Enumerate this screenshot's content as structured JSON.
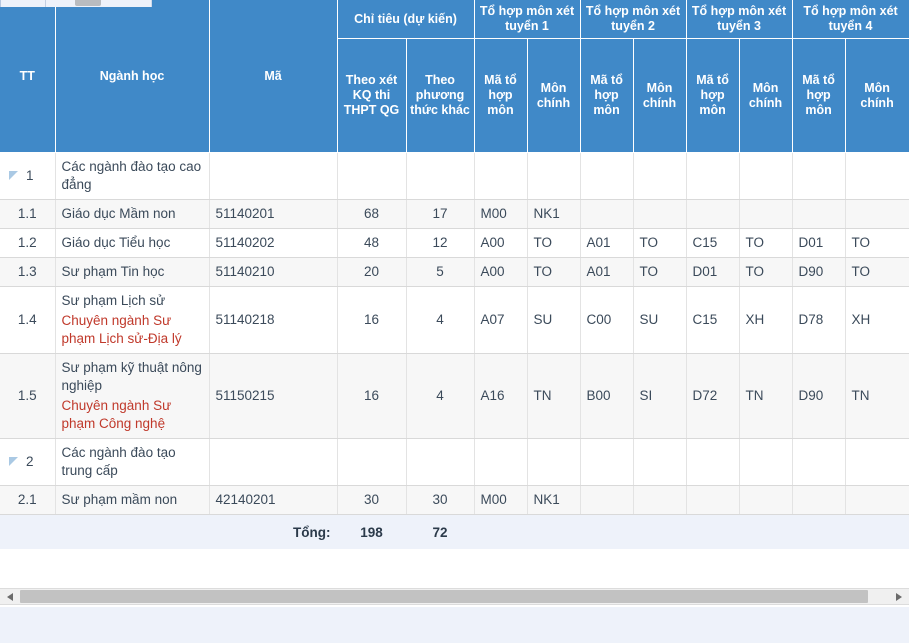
{
  "header": {
    "col_tt": "TT",
    "col_nganh": "Ngành học",
    "col_ma": "Mã",
    "group_chitieu": "Chỉ tiêu (dự kiến)",
    "sub_thpt": "Theo xét KQ thi THPT QG",
    "sub_khac": "Theo phương thức khác",
    "group_th1": "Tổ hợp môn xét tuyển 1",
    "group_th2": "Tổ hợp môn xét tuyển 2",
    "group_th3": "Tổ hợp môn xét tuyển 3",
    "group_th4": "Tổ hợp môn xét tuyển 4",
    "sub_ma_to_hop": "Mã tổ hợp môn",
    "sub_mon_chinh": "Môn chính"
  },
  "rows": [
    {
      "kind": "group",
      "tt": "1",
      "name": "Các ngành đào tạo cao đẳng",
      "name_sub": "",
      "ma": "",
      "thpt": "",
      "khac": "",
      "th1_ma": "",
      "th1_mon": "",
      "th2_ma": "",
      "th2_mon": "",
      "th3_ma": "",
      "th3_mon": "",
      "th4_ma": "",
      "th4_mon": ""
    },
    {
      "kind": "item",
      "tt": "1.1",
      "name": "Giáo dục Mầm non",
      "name_sub": "",
      "ma": "51140201",
      "thpt": "68",
      "khac": "17",
      "th1_ma": "M00",
      "th1_mon": "NK1",
      "th2_ma": "",
      "th2_mon": "",
      "th3_ma": "",
      "th3_mon": "",
      "th4_ma": "",
      "th4_mon": ""
    },
    {
      "kind": "item",
      "tt": "1.2",
      "name": "Giáo dục Tiểu học",
      "name_sub": "",
      "ma": "51140202",
      "thpt": "48",
      "khac": "12",
      "th1_ma": "A00",
      "th1_mon": "TO",
      "th2_ma": "A01",
      "th2_mon": "TO",
      "th3_ma": "C15",
      "th3_mon": "TO",
      "th4_ma": "D01",
      "th4_mon": "TO"
    },
    {
      "kind": "item",
      "tt": "1.3",
      "name": "Sư phạm Tin học",
      "name_sub": "",
      "ma": "51140210",
      "thpt": "20",
      "khac": "5",
      "th1_ma": "A00",
      "th1_mon": "TO",
      "th2_ma": "A01",
      "th2_mon": "TO",
      "th3_ma": "D01",
      "th3_mon": "TO",
      "th4_ma": "D90",
      "th4_mon": "TO"
    },
    {
      "kind": "item",
      "tt": "1.4",
      "name": "Sư phạm Lịch sử",
      "name_sub": "Chuyên ngành Sư phạm Lịch sử-Địa lý",
      "ma": "51140218",
      "thpt": "16",
      "khac": "4",
      "th1_ma": "A07",
      "th1_mon": "SU",
      "th2_ma": "C00",
      "th2_mon": "SU",
      "th3_ma": "C15",
      "th3_mon": "XH",
      "th4_ma": "D78",
      "th4_mon": "XH"
    },
    {
      "kind": "item",
      "tt": "1.5",
      "name": "Sư phạm kỹ thuật nông nghiệp",
      "name_sub": "Chuyên ngành Sư phạm Công nghệ",
      "ma": "51150215",
      "thpt": "16",
      "khac": "4",
      "th1_ma": "A16",
      "th1_mon": "TN",
      "th2_ma": "B00",
      "th2_mon": "SI",
      "th3_ma": "D72",
      "th3_mon": "TN",
      "th4_ma": "D90",
      "th4_mon": "TN"
    },
    {
      "kind": "group",
      "tt": "2",
      "name": "Các ngành đào tạo trung cấp",
      "name_sub": "",
      "ma": "",
      "thpt": "",
      "khac": "",
      "th1_ma": "",
      "th1_mon": "",
      "th2_ma": "",
      "th2_mon": "",
      "th3_ma": "",
      "th3_mon": "",
      "th4_ma": "",
      "th4_mon": ""
    },
    {
      "kind": "item",
      "tt": "2.1",
      "name": "Sư phạm mầm non",
      "name_sub": "",
      "ma": "42140201",
      "thpt": "30",
      "khac": "30",
      "th1_ma": "M00",
      "th1_mon": "NK1",
      "th2_ma": "",
      "th2_mon": "",
      "th3_ma": "",
      "th3_mon": "",
      "th4_ma": "",
      "th4_mon": ""
    }
  ],
  "footer": {
    "total_label": "Tổng:",
    "total_thpt": "198",
    "total_khac": "72"
  },
  "scrollbar": {
    "left_arrow": "◀",
    "right_arrow": "▶"
  },
  "colors": {
    "header_blue": "#4089c8",
    "sub_text_red": "#c0392b",
    "footer_bg": "#eef2fa",
    "alt_row": "#f7f7f7"
  }
}
